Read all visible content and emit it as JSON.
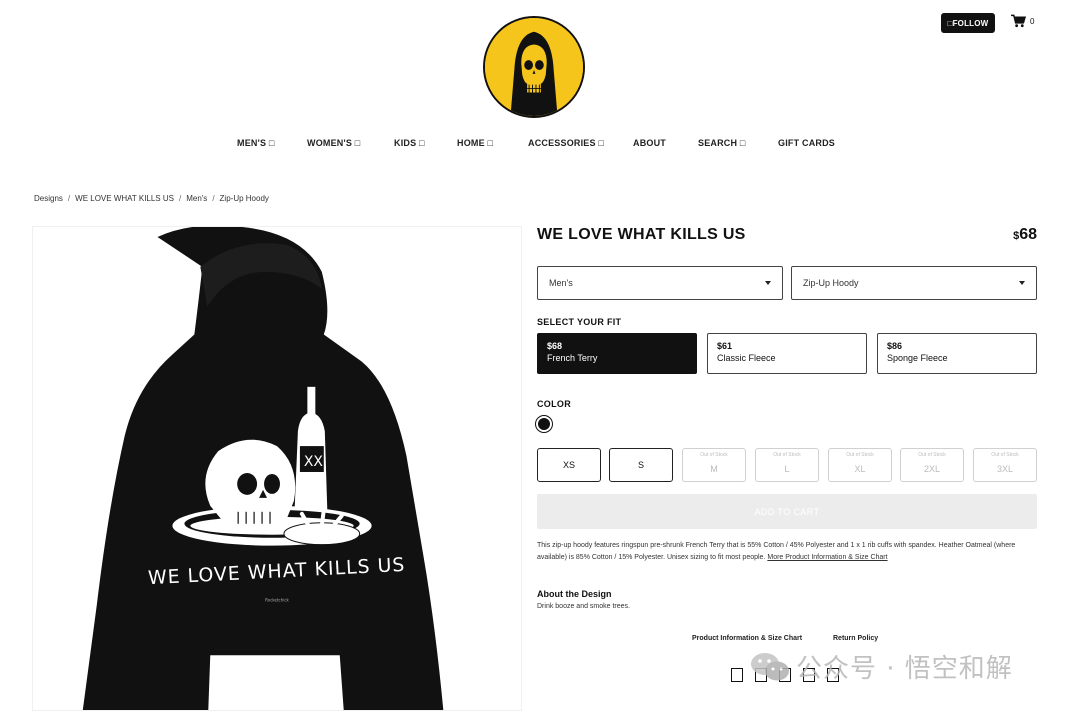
{
  "header": {
    "follow_label": "□FOLLOW",
    "cart_count": "0",
    "logo_icon": "skull-reaper-logo-icon",
    "cart_icon": "shopping-cart-icon"
  },
  "nav": {
    "items": [
      "MEN'S □",
      "WOMEN'S □",
      "KIDS □",
      "HOME □",
      "ACCESSORIES □",
      "ABOUT",
      "SEARCH □",
      "GIFT CARDS"
    ]
  },
  "breadcrumb": {
    "items": [
      "Designs",
      "WE LOVE WHAT KILLS US",
      "Men's",
      "Zip-Up Hoody"
    ],
    "separator": "/"
  },
  "product": {
    "title": "WE LOVE WHAT KILLS US",
    "price_currency": "$",
    "price_value": "68",
    "artwork_text": "WE LOVE WHAT KILLS US",
    "artwork_signature": "Rocketchick"
  },
  "selects": {
    "gender": "Men's",
    "style": "Zip-Up Hoody"
  },
  "fit": {
    "label": "SELECT YOUR FIT",
    "options": [
      {
        "price": "$68",
        "name": "French Terry",
        "selected": true
      },
      {
        "price": "$61",
        "name": "Classic Fleece",
        "selected": false
      },
      {
        "price": "$86",
        "name": "Sponge Fleece",
        "selected": false
      }
    ]
  },
  "color": {
    "label": "COLOR",
    "selected_hex": "#111111"
  },
  "sizes": {
    "out_of_stock_label": "Out of Stock",
    "options": [
      {
        "label": "XS",
        "in_stock": true
      },
      {
        "label": "S",
        "in_stock": true
      },
      {
        "label": "M",
        "in_stock": false
      },
      {
        "label": "L",
        "in_stock": false
      },
      {
        "label": "XL",
        "in_stock": false
      },
      {
        "label": "2XL",
        "in_stock": false
      },
      {
        "label": "3XL",
        "in_stock": false
      }
    ]
  },
  "add_to_cart": "ADD TO CART",
  "description": {
    "text": "This zip-up hoody features ringspun pre-shrunk French Terry that is 55% Cotton / 45% Polyester and 1 x 1 rib cuffs with spandex. Heather Oatmeal (where available) is 85% Cotton / 15% Polyester. Unisex sizing to fit most people.",
    "link": "More Product Information & Size Chart"
  },
  "about": {
    "title": "About the Design",
    "text": "Drink booze and smoke trees."
  },
  "footer": {
    "links": [
      "Product Information & Size Chart",
      "Return Policy"
    ],
    "social_placeholder": "□ □ □ □ □"
  },
  "watermark": {
    "text": "公众号 · 悟空和解",
    "icon": "wechat-icon"
  },
  "colors": {
    "logo_yellow": "#f6c51c",
    "primary_dark": "#111111",
    "disabled_gray": "#ececec"
  }
}
